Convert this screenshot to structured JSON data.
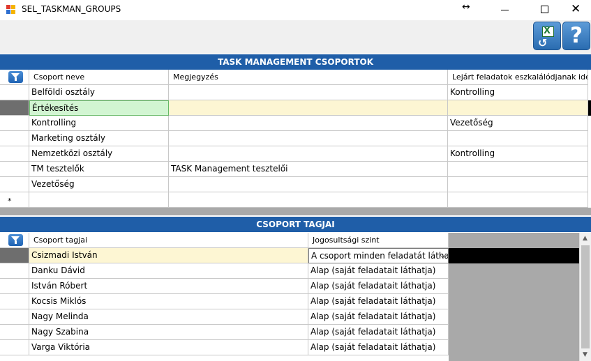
{
  "window": {
    "title": "SEL_TASKMAN_GROUPS",
    "resize_glyph": "↔",
    "close_glyph": "✕"
  },
  "toolbar": {
    "excel_icon": "excel-refresh-icon",
    "help_icon": "help-icon",
    "help_glyph": "?",
    "excel_glyph": "X",
    "refresh_glyph": "↺"
  },
  "groups": {
    "title": "TASK MANAGEMENT CSOPORTOK",
    "columns": [
      "Csoport neve",
      "Megjegyzés",
      "Lejárt feladatok eszkalálódjanak ide"
    ],
    "rows": [
      {
        "name": "Belföldi osztály",
        "note": "",
        "escalate": "Kontrolling"
      },
      {
        "name": "Értékesítés",
        "note": "",
        "escalate": ""
      },
      {
        "name": "Kontrolling",
        "note": "",
        "escalate": "Vezetőség"
      },
      {
        "name": "Marketing osztály",
        "note": "",
        "escalate": ""
      },
      {
        "name": "Nemzetközi osztály",
        "note": "",
        "escalate": "Kontrolling"
      },
      {
        "name": "TM tesztelők",
        "note": "TASK Management tesztelői",
        "escalate": ""
      },
      {
        "name": "Vezetőség",
        "note": "",
        "escalate": ""
      }
    ],
    "new_row_marker": "*"
  },
  "members": {
    "title": "CSOPORT TAGJAI",
    "columns": [
      "Csoport tagjai",
      "Jogosultsági szint"
    ],
    "rows": [
      {
        "name": "Csizmadi István",
        "level": "A csoport minden feladatát látha"
      },
      {
        "name": "Danku Dávid",
        "level": "Alap (saját feladatait láthatja)"
      },
      {
        "name": "István Róbert",
        "level": "Alap (saját feladatait láthatja)"
      },
      {
        "name": "Kocsis Miklós",
        "level": "Alap (saját feladatait láthatja)"
      },
      {
        "name": "Nagy Melinda",
        "level": "Alap (saját feladatait láthatja)"
      },
      {
        "name": "Nagy Szabina",
        "level": "Alap (saját feladatait láthatja)"
      },
      {
        "name": "Varga Viktória",
        "level": "Alap (saját feladatait láthatja)"
      }
    ],
    "dropdown_glyph": "⌵",
    "scroll_up": "▲",
    "scroll_down": "▼"
  },
  "colors": {
    "header_band": "#1f5ea8",
    "selected_row": "#fdf6d3",
    "selected_cell": "#d2f5d2"
  }
}
